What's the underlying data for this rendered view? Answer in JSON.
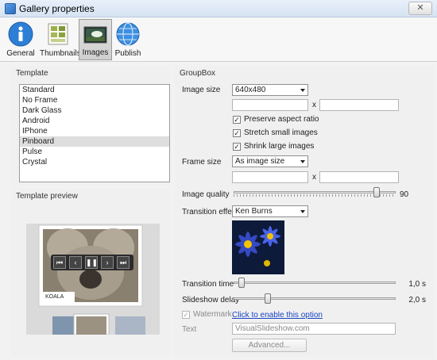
{
  "window": {
    "title": "Gallery properties",
    "close_label": "✕"
  },
  "toolbar": {
    "buttons": [
      {
        "label": "General",
        "icon": "info-icon"
      },
      {
        "label": "Thumbnails",
        "icon": "thumbnails-icon"
      },
      {
        "label": "Images",
        "icon": "images-icon",
        "active": true
      },
      {
        "label": "Publish",
        "icon": "globe-icon"
      }
    ]
  },
  "template": {
    "title": "Template",
    "items": [
      "Standard",
      "No Frame",
      "Dark Glass",
      "Android",
      "IPhone",
      "Pinboard",
      "Pulse",
      "Crystal"
    ],
    "selected": "Pinboard"
  },
  "preview": {
    "title": "Template preview",
    "caption": "KOALA"
  },
  "groupbox": {
    "title": "GroupBox",
    "image_size": {
      "label": "Image size",
      "value": "640x480",
      "width": "",
      "height": "",
      "x": "x"
    },
    "preserve_aspect": {
      "label": "Preserve aspect ratio",
      "checked": true
    },
    "stretch_small": {
      "label": "Stretch small images",
      "checked": true
    },
    "shrink_large": {
      "label": "Shrink large images",
      "checked": true
    },
    "frame_size": {
      "label": "Frame size",
      "value": "As image size",
      "width": "",
      "height": "",
      "x": "x"
    },
    "image_quality": {
      "label": "Image quality",
      "value": "90",
      "level": 0.9
    },
    "transition_effect": {
      "label": "Transition effect",
      "value": "Ken Burns"
    },
    "transition_time": {
      "label": "Transition time",
      "value": "1,0 s",
      "level": 0.03
    },
    "slideshow_delay": {
      "label": "Slideshow delay",
      "value": "2,0 s",
      "level": 0.2
    },
    "watermark": {
      "label": "Watermark",
      "checked": true,
      "link": "Click to enable this option"
    },
    "text": {
      "label": "Text",
      "value": "VisualSlideshow.com"
    },
    "advanced_label": "Advanced..."
  },
  "colors": {
    "accent": "#1a44c4",
    "selection": "#dedede"
  }
}
